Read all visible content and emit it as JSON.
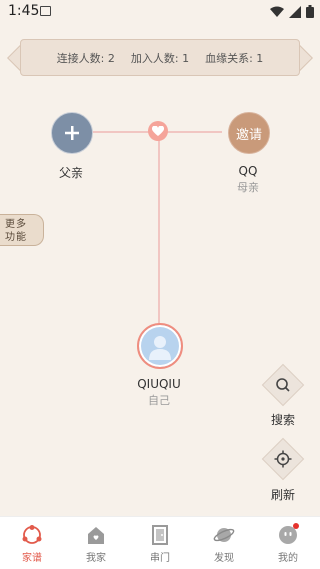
{
  "status_bar": {
    "time": "1:45"
  },
  "stats": {
    "connected": "连接人数: 2",
    "joined": "加入人数: 1",
    "blood": "血缘关系: 1"
  },
  "tree": {
    "father": {
      "name": "父亲",
      "icon": "plus-icon"
    },
    "mother": {
      "avatar_text": "邀请",
      "name": "QQ",
      "role": "母亲"
    },
    "self": {
      "name": "QIUQIU",
      "role": "自己"
    }
  },
  "more_functions": {
    "line1": "更多",
    "line2": "功能"
  },
  "actions": {
    "search": "搜索",
    "refresh": "刷新"
  },
  "nav": {
    "items": [
      {
        "label": "家谱",
        "icon": "family-tree-icon",
        "active": true
      },
      {
        "label": "我家",
        "icon": "home-icon"
      },
      {
        "label": "串门",
        "icon": "door-icon"
      },
      {
        "label": "发现",
        "icon": "planet-icon"
      },
      {
        "label": "我的",
        "icon": "profile-icon",
        "badge": true
      }
    ]
  },
  "colors": {
    "accent": "#e25a4b",
    "background": "#f7f1ea",
    "line": "#f1c6c2"
  }
}
